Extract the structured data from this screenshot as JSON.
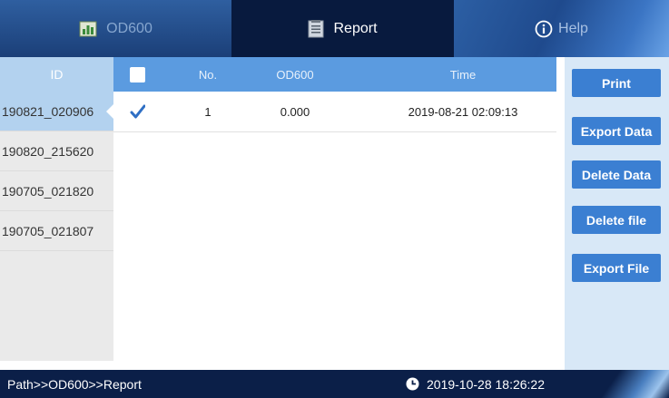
{
  "tabs": {
    "od600": "OD600",
    "report": "Report",
    "help": "Help",
    "active": "Report"
  },
  "id_list": {
    "header": "ID",
    "items": [
      "190821_020906",
      "190820_215620",
      "190705_021820",
      "190705_021807"
    ],
    "selected": "190821_020906"
  },
  "table": {
    "columns": {
      "no": "No.",
      "od600": "OD600",
      "time": "Time"
    },
    "header_checked": false,
    "rows": [
      {
        "checked": true,
        "no": "1",
        "od600": "0.000",
        "time": "2019-08-21 02:09:13"
      }
    ]
  },
  "actions": {
    "print": "Print",
    "export_data": "Export Data",
    "delete_data": "Delete Data",
    "delete_file": "Delete file",
    "export_file": "Export File"
  },
  "status": {
    "path": "Path>>OD600>>Report",
    "datetime": "2019-10-28 18:26:22"
  },
  "icons": {
    "od600_tab": "chart-icon",
    "report_tab": "report-icon",
    "help_tab": "info-icon",
    "clock": "clock-icon"
  },
  "colors": {
    "accent": "#5b9be0",
    "button": "#3b7fd2",
    "dark_bar": "#0b1f48",
    "selected_item": "#b3d2ef"
  }
}
